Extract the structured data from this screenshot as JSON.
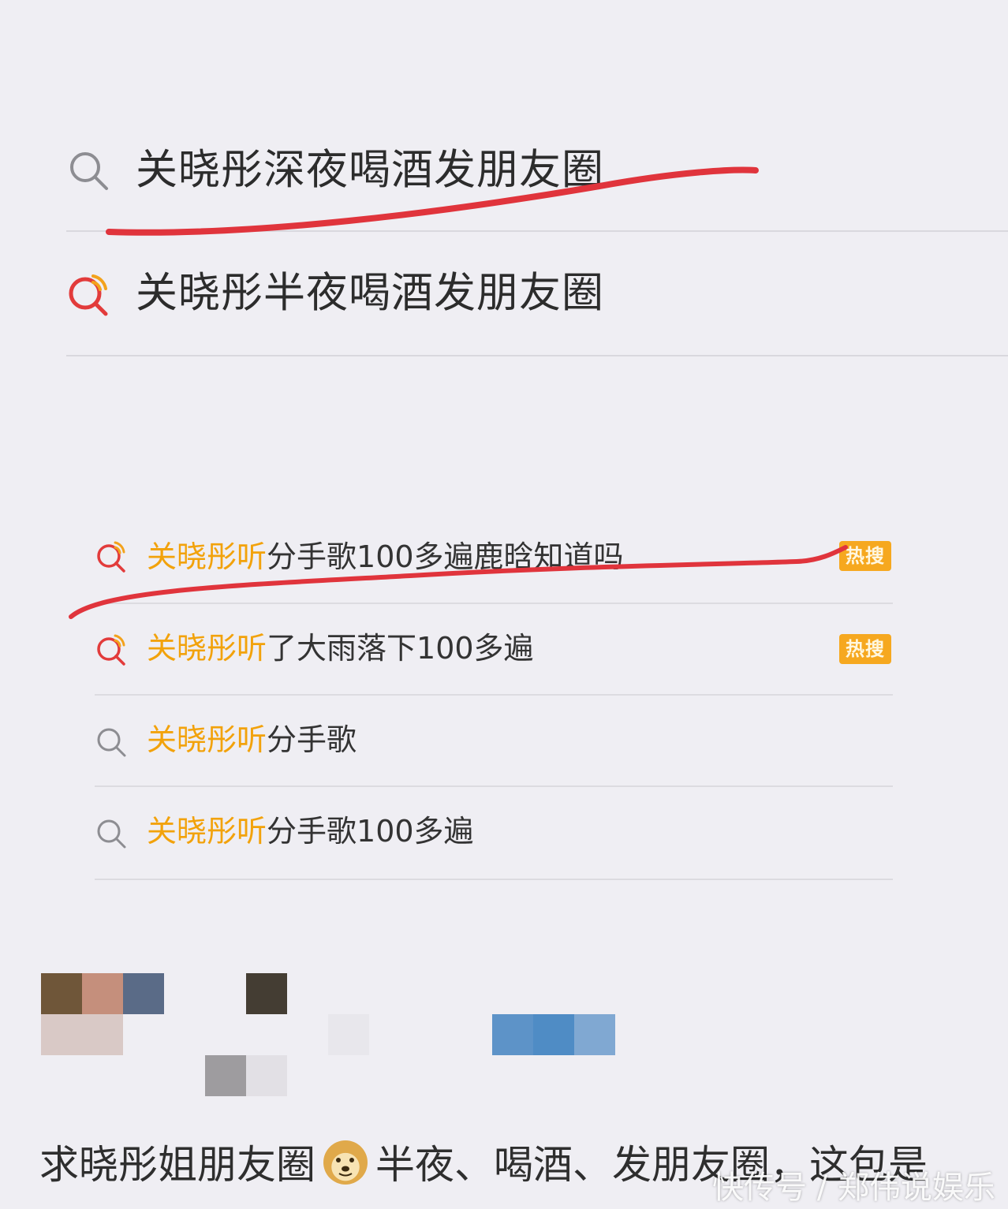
{
  "search_history": [
    {
      "text": "关晓彤深夜喝酒发朋友圈",
      "icon": "search-icon"
    },
    {
      "text": "关晓彤半夜喝酒发朋友圈",
      "icon": "trending-search-icon"
    }
  ],
  "suggestions": [
    {
      "highlight": "关晓彤听",
      "rest": "分手歌100多遍鹿晗知道吗",
      "icon": "trending-search-icon",
      "badge": "热搜"
    },
    {
      "highlight": "关晓彤听",
      "rest": "了大雨落下100多遍",
      "icon": "trending-search-icon",
      "badge": "热搜"
    },
    {
      "highlight": "关晓彤听",
      "rest": "分手歌",
      "icon": "search-icon",
      "badge": ""
    },
    {
      "highlight": "关晓彤听",
      "rest": "分手歌100多遍",
      "icon": "search-icon",
      "badge": ""
    }
  ],
  "post": {
    "text_before": "求晓彤姐朋友圈",
    "emoji": "doge-emoji",
    "text_after": "半夜、喝酒、发朋友圈，这包是"
  },
  "watermark": "快传号 / 郑伟说娱乐",
  "colors": {
    "background": "#efeef3",
    "highlight": "#f2a20b",
    "badge": "#f6a81f",
    "scribble": "#e0343c",
    "trending_icon_red": "#e23b3b",
    "trending_icon_orange": "#f3a21c"
  }
}
